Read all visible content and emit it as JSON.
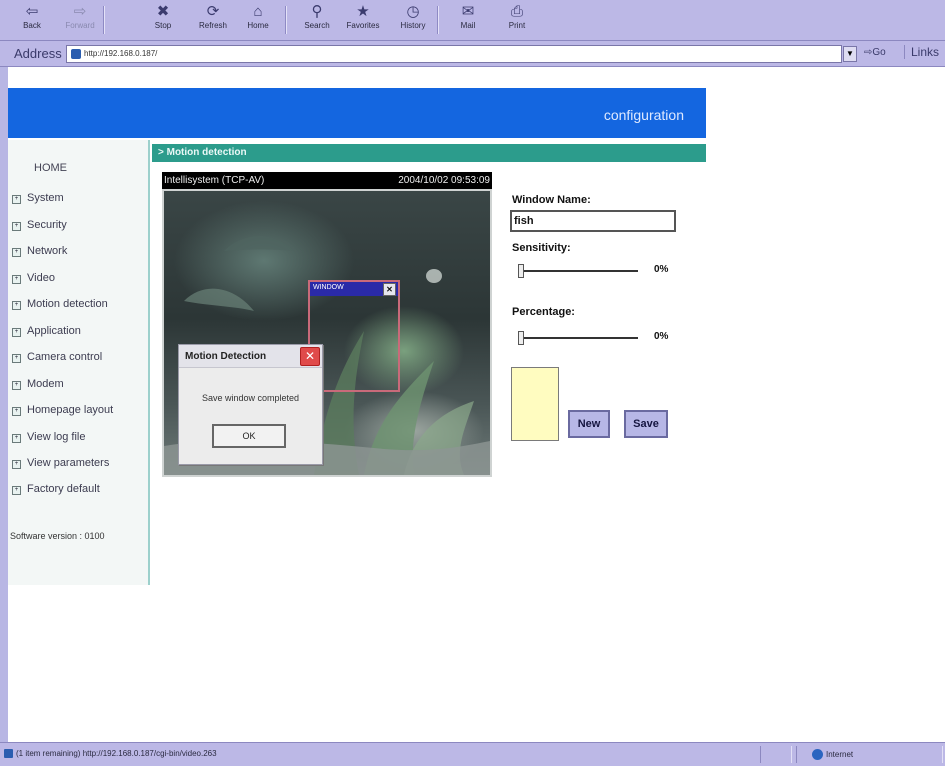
{
  "toolbar": {
    "buttons": [
      {
        "label": "Back",
        "icon": "back-arrow-icon"
      },
      {
        "label": "Forward",
        "icon": "forward-arrow-icon"
      },
      {
        "label": "Stop",
        "icon": "stop-icon"
      },
      {
        "label": "Refresh",
        "icon": "refresh-icon"
      },
      {
        "label": "Home",
        "icon": "home-icon"
      },
      {
        "label": "Search",
        "icon": "search-icon"
      },
      {
        "label": "Favorites",
        "icon": "favorites-icon"
      },
      {
        "label": "History",
        "icon": "history-icon"
      },
      {
        "label": "Mail",
        "icon": "mail-icon"
      },
      {
        "label": "Print",
        "icon": "print-icon"
      }
    ]
  },
  "address_bar": {
    "label": "Address",
    "url": "http://192.168.0.187/",
    "go_label": "Go",
    "links_label": "Links"
  },
  "banner": {
    "title": "configuration"
  },
  "sidebar": {
    "home": "HOME",
    "items": [
      "System",
      "Security",
      "Network",
      "Video",
      "Motion detection",
      "Application",
      "Camera control",
      "Modem",
      "Homepage layout",
      "View log file",
      "View parameters",
      "Factory default"
    ],
    "software_version": "Software version : 0100"
  },
  "section": {
    "title": "> Motion detection"
  },
  "camera": {
    "name": "Intellisystem (TCP-AV)",
    "timestamp": "2004/10/02 09:53:09",
    "detection_window_label": "WINDOW"
  },
  "dialog": {
    "title": "Motion Detection",
    "message": "Save window completed",
    "ok_label": "OK"
  },
  "form": {
    "window_name_label": "Window Name:",
    "window_name_value": "fish",
    "sensitivity_label": "Sensitivity:",
    "sensitivity_value": "0%",
    "sensitivity_level": 0,
    "percentage_label": "Percentage:",
    "percentage_value": "0%",
    "percentage_level": 0,
    "new_label": "New",
    "save_label": "Save"
  },
  "statusbar": {
    "text": "(1 item remaining) http://192.168.0.187/cgi-bin/video.263",
    "zone": "Internet"
  },
  "colors": {
    "chrome": "#bcb8e6",
    "banner": "#1466e0",
    "section_bar": "#2c9c8c",
    "preview_fill": "#fffcc0",
    "dialog_close": "#e04a4a"
  }
}
